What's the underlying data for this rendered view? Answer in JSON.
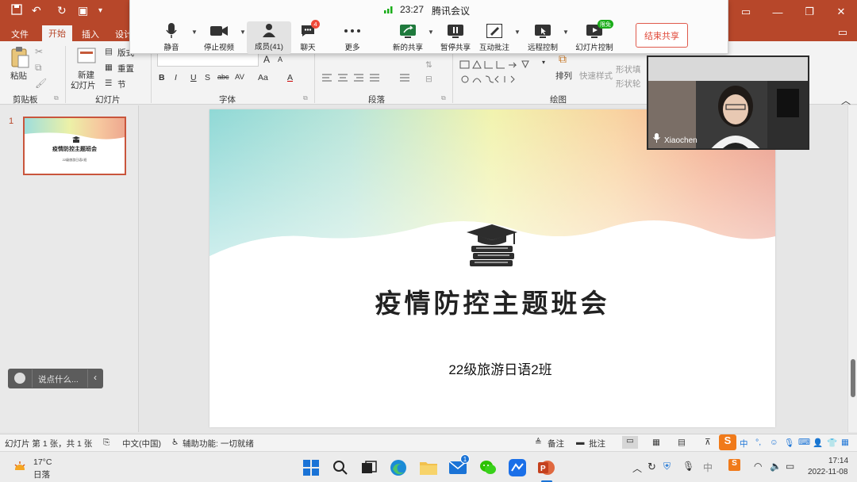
{
  "app": {
    "accent": "#b7472a"
  },
  "ribbon_tabs": {
    "file": "文件",
    "home": "开始",
    "insert": "插入",
    "design": "设计"
  },
  "meeting": {
    "time": "23:27",
    "title": "腾讯会议",
    "buttons": {
      "mute": "静音",
      "stop_video": "停止视频",
      "members": "成员(41)",
      "chat": "聊天",
      "chat_badge": "4",
      "more": "更多",
      "new_share": "新的共享",
      "pause_share": "暂停共享",
      "annotate": "互动批注",
      "remote_control": "远程控制",
      "slide_control": "幻灯片控制",
      "slide_control_badge": "限免",
      "end_share": "结束共享"
    },
    "participant_name": "Xiaochen"
  },
  "ribbon": {
    "clipboard": {
      "paste": "粘贴",
      "label": "剪贴板"
    },
    "slides": {
      "new_slide_1": "新建",
      "new_slide_2": "幻灯片",
      "layout": "版式",
      "reset": "重置",
      "section": "节",
      "label": "幻灯片"
    },
    "font": {
      "label": "字体",
      "bold": "B",
      "italic": "I",
      "underline": "U",
      "shadow": "S",
      "strike": "abc",
      "spacing": "AV",
      "case": "Aa",
      "color": "A",
      "grow": "A",
      "shrink": "A"
    },
    "paragraph": {
      "label": "段落"
    },
    "drawing": {
      "label": "绘图",
      "arrange": "排列",
      "quick_styles": "快速样式",
      "shape_fill": "形状填",
      "shape_outline": "形状轮"
    }
  },
  "thumbnail": {
    "number": "1",
    "title": "疫情防控主题班会",
    "subtitle": "22级旅游日语2班"
  },
  "slide": {
    "title": "疫情防控主题班会",
    "subtitle": "22级旅游日语2班"
  },
  "chat_pill": {
    "placeholder": "说点什么..."
  },
  "status_bar": {
    "slide_info": "幻灯片 第 1 张，共 1 张",
    "language": "中文(中国)",
    "accessibility": "辅助功能: 一切就绪",
    "notes": "备注",
    "comments": "批注"
  },
  "taskbar": {
    "weather_temp": "17°C",
    "weather_desc": "日落",
    "mail_badge": "1",
    "time": "17:14",
    "date": "2022-11-08",
    "ime": "中"
  }
}
